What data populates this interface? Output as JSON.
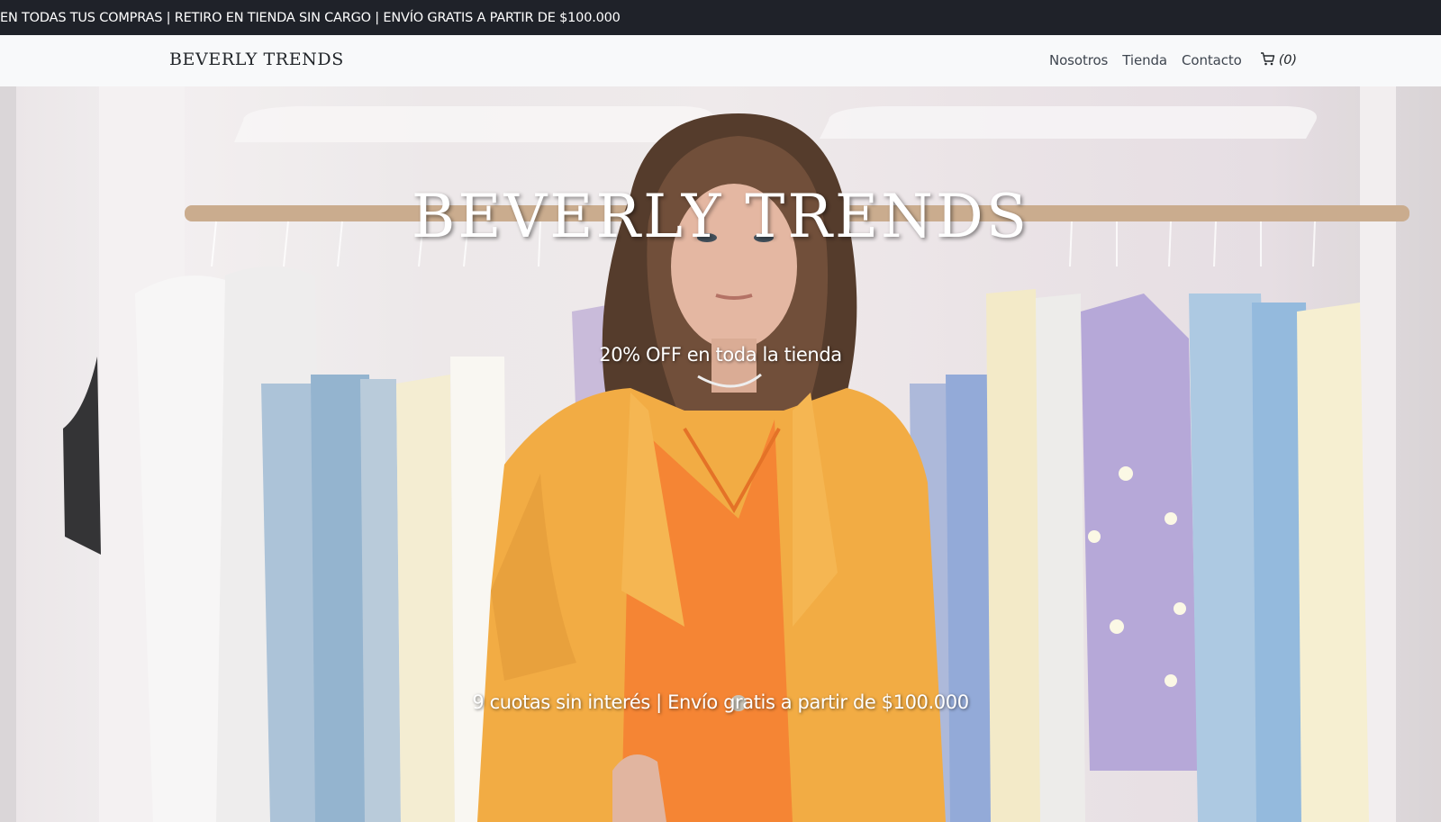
{
  "announcement": {
    "text": "EN TODAS TUS COMPRAS | RETIRO EN TIENDA SIN CARGO | ENVÍO GRATIS A PARTIR DE $100.000"
  },
  "navbar": {
    "brand": "BEVERLY TRENDS",
    "links": [
      {
        "label": "Nosotros"
      },
      {
        "label": "Tienda"
      },
      {
        "label": "Contacto"
      }
    ],
    "cart": {
      "icon": "cart-icon",
      "count": "(0)"
    }
  },
  "hero": {
    "title": "BEVERLY TRENDS",
    "promo": "20% OFF en toda la tienda",
    "shipping": "9 cuotas sin interés | Envío gratis a partir de $100.000"
  },
  "colors": {
    "announce_bg": "#1f2229",
    "navbar_bg": "#f8f9fa",
    "jacket": "#f2a83a",
    "sweater": "#f57f2a"
  }
}
